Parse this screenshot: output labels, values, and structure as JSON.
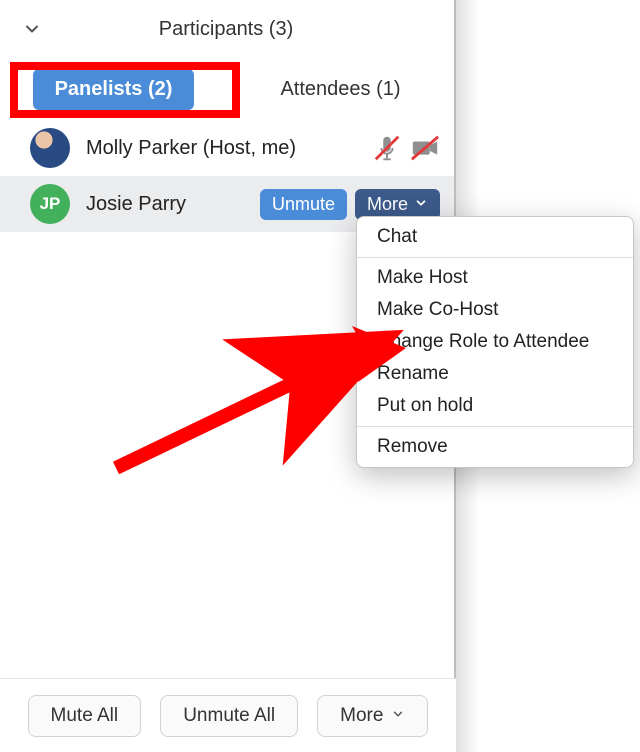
{
  "header": {
    "title": "Participants (3)"
  },
  "tabs": {
    "panelists": "Panelists (2)",
    "attendees": "Attendees (1)"
  },
  "participants": {
    "host": {
      "name": "Molly Parker (Host, me)"
    },
    "panelist": {
      "initials": "JP",
      "name": "Josie Parry",
      "unmute": "Unmute",
      "more": "More"
    }
  },
  "menu": {
    "chat": "Chat",
    "make_host": "Make Host",
    "make_cohost": "Make Co-Host",
    "change_role": "Change Role to Attendee",
    "rename": "Rename",
    "put_on_hold": "Put on hold",
    "remove": "Remove"
  },
  "footer": {
    "mute_all": "Mute All",
    "unmute_all": "Unmute All",
    "more": "More"
  }
}
